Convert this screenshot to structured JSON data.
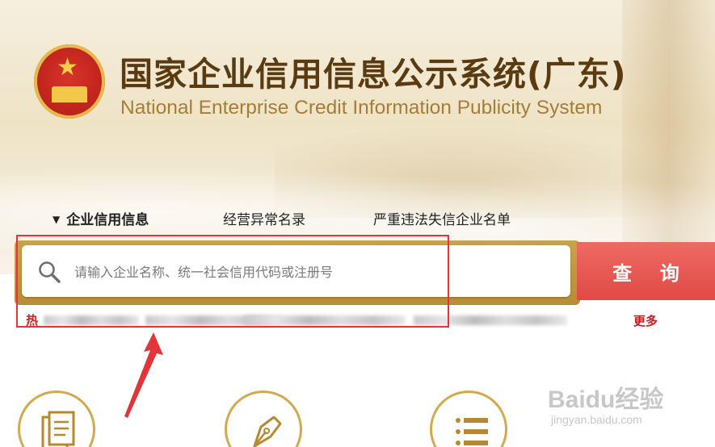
{
  "header": {
    "title": "国家企业信用信息公示系统(广东)",
    "subtitle": "National Enterprise Credit Information Publicity System"
  },
  "tabs": [
    {
      "label": "企业信用信息",
      "active": true
    },
    {
      "label": "经营异常名录",
      "active": false
    },
    {
      "label": "严重违法失信企业名单",
      "active": false
    }
  ],
  "search": {
    "placeholder": "请输入企业名称、统一社会信用代码或注册号",
    "value": "",
    "button_label": "查 询"
  },
  "hot_search": {
    "label": "热",
    "more_label": "更多"
  },
  "features": [
    {
      "icon": "document-icon"
    },
    {
      "icon": "pen-nib-icon"
    },
    {
      "icon": "list-icon"
    }
  ],
  "watermark": {
    "main": "Baidu经验",
    "sub": "jingyan.baidu.com"
  },
  "colors": {
    "accent_gold": "#b88d34",
    "search_button": "#e04a45",
    "highlight": "#e3343a",
    "title_brown": "#5a3a10"
  }
}
